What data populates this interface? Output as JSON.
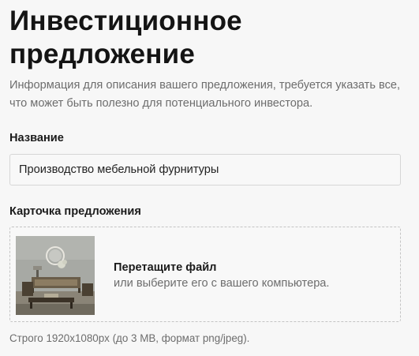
{
  "page": {
    "title": "Инвестиционное предложение",
    "description": "Информация для описания вашего предложения, требуется указать все, что может быть полезно для потенциального инвестора."
  },
  "name_field": {
    "label": "Название",
    "value": "Производство мебельной фурнитуры"
  },
  "card_field": {
    "label": "Карточка предложения",
    "dropzone_title": "Перетащите файл",
    "dropzone_subtitle": "или выберите его с вашего компьютера.",
    "thumbnail_icon": "interior-photo",
    "hint": "Строго 1920x1080px (до 3 MB, формат png/jpeg)."
  }
}
